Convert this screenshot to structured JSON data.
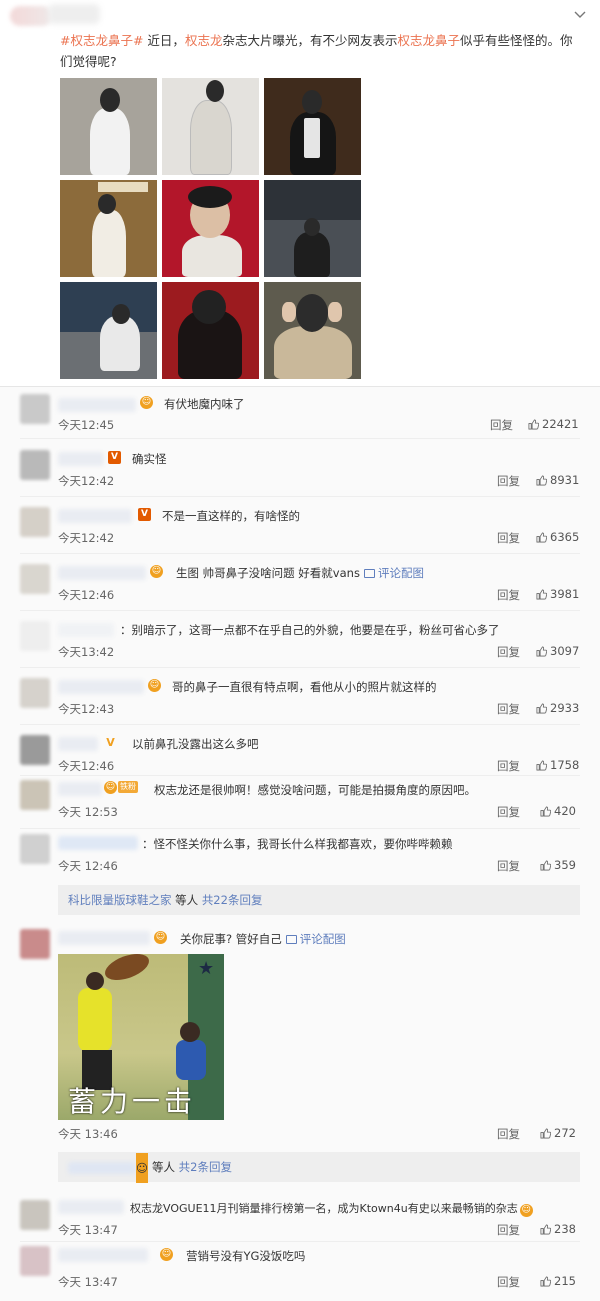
{
  "post": {
    "hashtag": "#权志龙鼻子#",
    "text_1": " 近日，",
    "mention": "权志龙",
    "text_2": "杂志大片曝光，有不少网友表示",
    "link_2": "权志龙鼻子",
    "text_3": "似乎有些怪怪的。你们觉得呢?",
    "chevron_icon": "chevron-down-icon"
  },
  "comments": [
    {
      "text": "有伏地魔内味了",
      "time": "今天12:45",
      "reply": "回复",
      "likes": "22421"
    },
    {
      "text": "确实怪",
      "time": "今天12:42",
      "reply": "回复",
      "likes": "8931"
    },
    {
      "text": "不是一直这样的，有啥怪的",
      "time": "今天12:42",
      "reply": "回复",
      "likes": "6365"
    },
    {
      "text": "生图 帅哥鼻子没啥问题 好看就vans",
      "link": "评论配图",
      "time": "今天12:46",
      "reply": "回复",
      "likes": "3981"
    },
    {
      "text": "别暗示了，这哥一点都不在乎自己的外貌，他要是在乎，粉丝可省心多了",
      "time": "今天13:42",
      "reply": "回复",
      "likes": "3097"
    },
    {
      "text": "哥的鼻子一直很有特点啊，看他从小的照片就这样的",
      "time": "今天12:43",
      "reply": "回复",
      "likes": "2933"
    },
    {
      "text": "以前鼻孔没露出这么多吧",
      "time": "今天12:46",
      "reply": "回复",
      "likes": "1758"
    },
    {
      "text": "权志龙还是很帅啊！感觉没啥问题，可能是拍摄角度的原因吧。",
      "time": "今天 12:53",
      "reply": "回复",
      "likes": "420"
    },
    {
      "text": "怪不怪关你什么事，我哥长什么样我都喜欢，要你哔哔赖赖",
      "time": "今天 12:46",
      "reply": "回复",
      "likes": "359"
    },
    {
      "text": "关你屁事? 管好自己",
      "link": "评论配图",
      "time": "今天 13:46",
      "reply": "回复",
      "likes": "272"
    },
    {
      "text": "权志龙VOGUE11月刊销量排行榜第一名，成为Ktown4u有史以来最畅销的杂志",
      "time": "今天 13:47",
      "reply": "回复",
      "likes": "238"
    },
    {
      "text": "营销号没有YG没饭吃吗",
      "time": "今天 13:47",
      "reply": "回复",
      "likes": "215"
    }
  ],
  "subreply_1": {
    "name": "科比限量版球鞋之家",
    "mid": " 等人 ",
    "count": "共22条回复"
  },
  "subreply_2": {
    "mid": "等人 ",
    "count": "共2条回复"
  },
  "gif_caption": "蓄力一击",
  "badge_v": "V",
  "badge_fan": "铁粉"
}
